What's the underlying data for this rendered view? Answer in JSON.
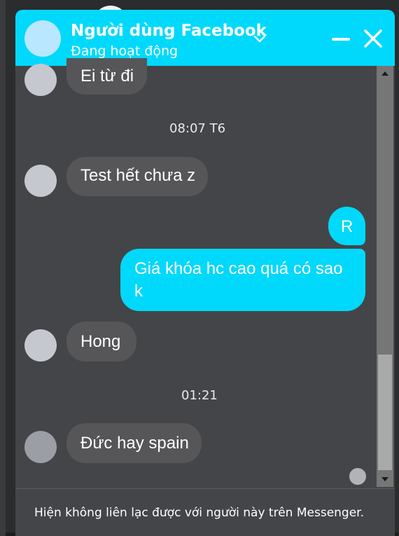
{
  "header": {
    "contact_name": "Người dùng Facebook",
    "status": "Đang hoạt động",
    "chevron_icon": "chevron-down-icon",
    "minimize_icon": "minimize-icon",
    "close_icon": "close-icon"
  },
  "messages": [
    {
      "sender": "them",
      "text": "Ei từ đi"
    },
    {
      "type": "timestamp",
      "text": "08:07 T6"
    },
    {
      "sender": "them",
      "text": "Test hết chưa z"
    },
    {
      "sender": "me",
      "text": "R"
    },
    {
      "sender": "me",
      "text": "Giá khóa hc cao quá có sao k"
    },
    {
      "sender": "them",
      "text": "Hong"
    },
    {
      "type": "timestamp",
      "text": "01:21"
    },
    {
      "sender": "them",
      "text": "Đức hay spain"
    }
  ],
  "footer": {
    "notice": "Hiện không liên lạc được với người này trên Messenger."
  },
  "colors": {
    "accent": "#00d9fb",
    "panel": "#444548",
    "incoming_bubble": "#565658"
  }
}
